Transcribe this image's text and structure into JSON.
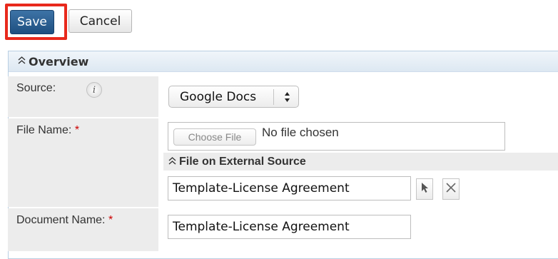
{
  "toolbar": {
    "save_label": "Save",
    "cancel_label": "Cancel",
    "highlight_color": "#e8291c"
  },
  "overview": {
    "title": "Overview",
    "collapse_icon": "double-chevron-up-icon"
  },
  "fields": {
    "source": {
      "label": "Source:",
      "info_icon": "info-icon",
      "info_glyph": "i",
      "value": "Google Docs"
    },
    "file_name": {
      "label": "File Name:",
      "required_mark": "*",
      "choose_label": "Choose File",
      "status": "No file chosen"
    },
    "external": {
      "title": "File on External Source",
      "value": "Template-License Agreement",
      "select_icon": "cursor-arrow-icon",
      "clear_icon": "close-x-icon"
    },
    "document_name": {
      "label": "Document Name:",
      "required_mark": "*",
      "value": "Template-License Agreement"
    }
  },
  "colors": {
    "primary_button": "#1e4f80",
    "required": "#cc0000",
    "panel_header": "#dde8f2"
  }
}
